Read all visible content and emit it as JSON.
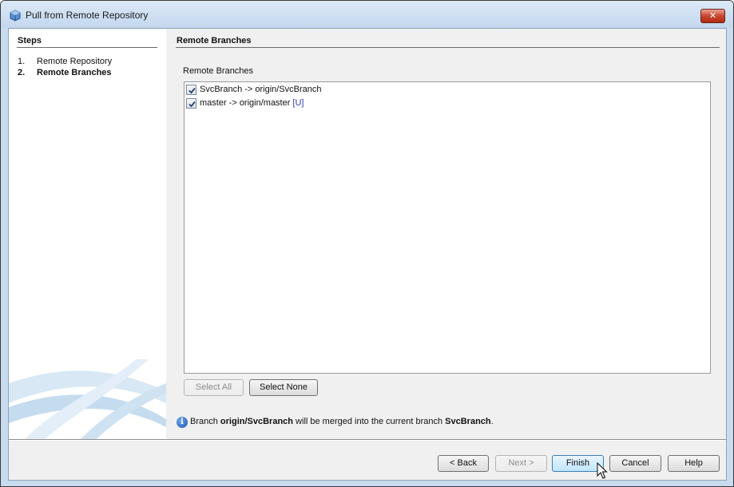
{
  "window": {
    "title": "Pull from Remote Repository",
    "close_label": "✕"
  },
  "steps": {
    "heading": "Steps",
    "items": [
      {
        "number": "1.",
        "label": "Remote Repository",
        "current": false
      },
      {
        "number": "2.",
        "label": "Remote Branches",
        "current": true
      }
    ]
  },
  "page": {
    "heading": "Remote Branches",
    "list_label": "Remote Branches",
    "branches": [
      {
        "checked": true,
        "text": "SvcBranch -> origin/SvcBranch",
        "tag": ""
      },
      {
        "checked": true,
        "text": "master -> origin/master",
        "tag": "[U]"
      }
    ],
    "select_all_label": "Select All",
    "select_none_label": "Select None",
    "info": {
      "prefix": "Branch ",
      "source_branch": "origin/SvcBranch",
      "middle": " will be merged into the current branch ",
      "target_branch": "SvcBranch",
      "suffix": "."
    }
  },
  "footer": {
    "back_label": "< Back",
    "next_label": "Next >",
    "finish_label": "Finish",
    "cancel_label": "Cancel",
    "help_label": "Help"
  },
  "icons": {
    "app": "netbeans-cube-icon",
    "close": "close-icon",
    "info": "info-icon",
    "checkbox": "checkbox-checked-icon",
    "cursor": "mouse-pointer-icon"
  },
  "colors": {
    "titlebar": "#c9dbef",
    "close_button": "#c9472e",
    "tag_text": "#2a3cb8",
    "info_icon": "#1c58b4",
    "finish_highlight": "#bee6fd"
  }
}
